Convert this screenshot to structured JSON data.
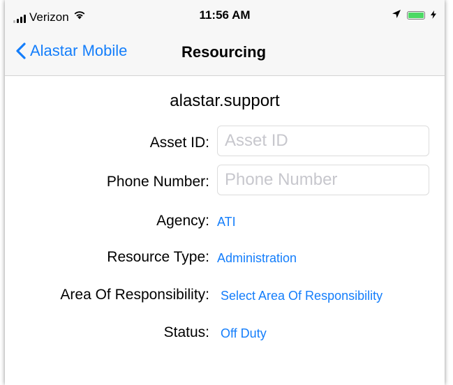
{
  "status_bar": {
    "carrier": "Verizon",
    "time": "11:56 AM"
  },
  "nav": {
    "back_label": "Alastar Mobile",
    "title": "Resourcing"
  },
  "form": {
    "username": "alastar.support",
    "asset_id": {
      "label": "Asset ID:",
      "value": "",
      "placeholder": "Asset ID"
    },
    "phone_number": {
      "label": "Phone Number:",
      "value": "",
      "placeholder": "Phone Number"
    },
    "agency": {
      "label": "Agency:",
      "value": "ATI"
    },
    "resource_type": {
      "label": "Resource Type:",
      "value": "Administration"
    },
    "area_of_responsibility": {
      "label": "Area Of Responsibility:",
      "value": "Select Area Of Responsibility"
    },
    "status": {
      "label": "Status:",
      "value": "Off Duty"
    }
  },
  "colors": {
    "accent": "#147efb",
    "bar_background": "#f7f7f7",
    "battery": "#4cd964"
  }
}
